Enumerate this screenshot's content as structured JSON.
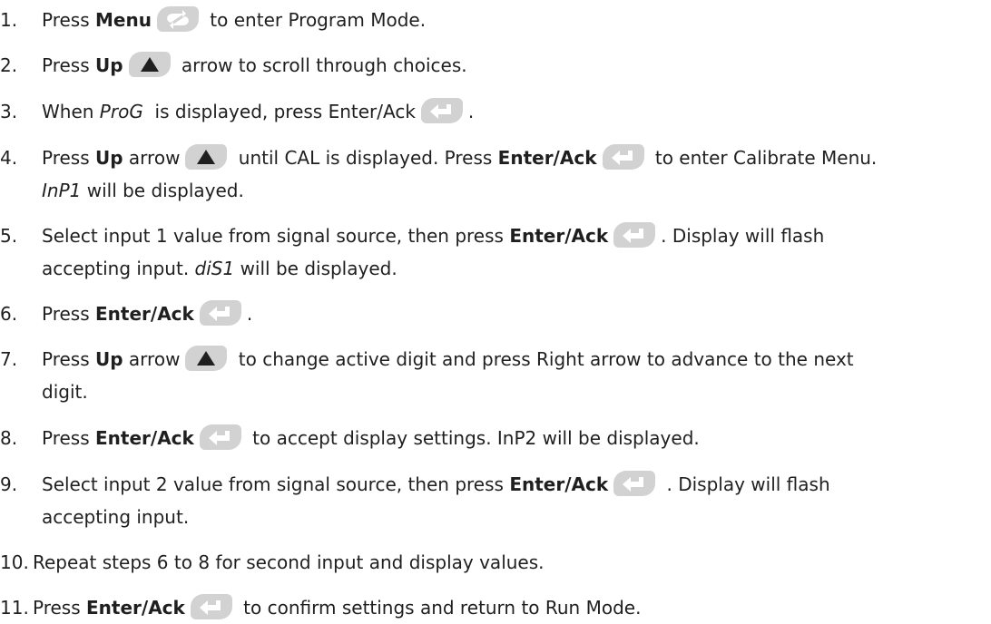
{
  "icons": {
    "menu": "menu-loop-icon",
    "up": "up-arrow-icon",
    "enter": "enter-ack-icon"
  },
  "colors": {
    "text": "#1f1f1f",
    "key_background": "#d2d2d2",
    "key_symbol": "#ffffff",
    "up_symbol": "#1f1f1f"
  },
  "steps": [
    {
      "number": "1.",
      "lines": [
        [
          {
            "t": "text",
            "v": "Press "
          },
          {
            "t": "bold",
            "v": "Menu"
          },
          {
            "t": "key",
            "k": "menu"
          },
          {
            "t": "text",
            "v": " to enter Program Mode."
          }
        ]
      ]
    },
    {
      "number": "2.",
      "lines": [
        [
          {
            "t": "text",
            "v": "Press "
          },
          {
            "t": "bold",
            "v": "Up"
          },
          {
            "t": "key",
            "k": "up"
          },
          {
            "t": "text",
            "v": " arrow to scroll through choices."
          }
        ]
      ]
    },
    {
      "number": "3.",
      "lines": [
        [
          {
            "t": "text",
            "v": "When "
          },
          {
            "t": "italic",
            "v": "ProG"
          },
          {
            "t": "text",
            "v": "  is displayed, press Enter/Ack"
          },
          {
            "t": "key",
            "k": "enter"
          },
          {
            "t": "text",
            "v": "."
          }
        ]
      ]
    },
    {
      "number": "4.",
      "lines": [
        [
          {
            "t": "text",
            "v": "Press "
          },
          {
            "t": "bold",
            "v": "Up"
          },
          {
            "t": "text",
            "v": " arrow"
          },
          {
            "t": "key",
            "k": "up"
          },
          {
            "t": "text",
            "v": " until CAL is displayed. Press "
          },
          {
            "t": "bold",
            "v": "Enter/Ack"
          },
          {
            "t": "key",
            "k": "enter"
          },
          {
            "t": "text",
            "v": " to enter Calibrate Menu."
          }
        ],
        [
          {
            "t": "italic",
            "v": "InP1"
          },
          {
            "t": "text",
            "v": " will be displayed."
          }
        ]
      ]
    },
    {
      "number": "5.",
      "lines": [
        [
          {
            "t": "text",
            "v": "Select input 1 value from signal source, then press "
          },
          {
            "t": "bold",
            "v": "Enter/Ack"
          },
          {
            "t": "key",
            "k": "enter"
          },
          {
            "t": "text",
            "v": ". Display will flash"
          }
        ],
        [
          {
            "t": "text",
            "v": "accepting input. "
          },
          {
            "t": "italic",
            "v": "diS1"
          },
          {
            "t": "text",
            "v": " will be displayed."
          }
        ]
      ]
    },
    {
      "number": "6.",
      "lines": [
        [
          {
            "t": "text",
            "v": "Press "
          },
          {
            "t": "bold",
            "v": "Enter/Ack"
          },
          {
            "t": "key",
            "k": "enter"
          },
          {
            "t": "text",
            "v": "."
          }
        ]
      ]
    },
    {
      "number": "7.",
      "lines": [
        [
          {
            "t": "text",
            "v": "Press "
          },
          {
            "t": "bold",
            "v": "Up"
          },
          {
            "t": "text",
            "v": " arrow"
          },
          {
            "t": "key",
            "k": "up"
          },
          {
            "t": "text",
            "v": " to change active digit and press Right arrow to advance to the next"
          }
        ],
        [
          {
            "t": "text",
            "v": "digit."
          }
        ]
      ]
    },
    {
      "number": "8.",
      "lines": [
        [
          {
            "t": "text",
            "v": "Press "
          },
          {
            "t": "bold",
            "v": "Enter/Ack"
          },
          {
            "t": "key",
            "k": "enter"
          },
          {
            "t": "text",
            "v": " to accept display settings. InP2 will be displayed."
          }
        ]
      ]
    },
    {
      "number": "9.",
      "lines": [
        [
          {
            "t": "text",
            "v": "Select input 2 value from signal source, then press "
          },
          {
            "t": "bold",
            "v": "Enter/Ack"
          },
          {
            "t": "key",
            "k": "enter"
          },
          {
            "t": "text",
            "v": " . Display will flash"
          }
        ],
        [
          {
            "t": "text",
            "v": "accepting input."
          }
        ]
      ]
    },
    {
      "number": "10.",
      "lines": [
        [
          {
            "t": "text",
            "v": "Repeat steps 6 to 8 for second input and display values."
          }
        ]
      ]
    },
    {
      "number": "11.",
      "lines": [
        [
          {
            "t": "text",
            "v": "Press "
          },
          {
            "t": "bold",
            "v": "Enter/Ack"
          },
          {
            "t": "key",
            "k": "enter"
          },
          {
            "t": "text",
            "v": " to confirm settings and return to Run Mode."
          }
        ]
      ]
    }
  ]
}
